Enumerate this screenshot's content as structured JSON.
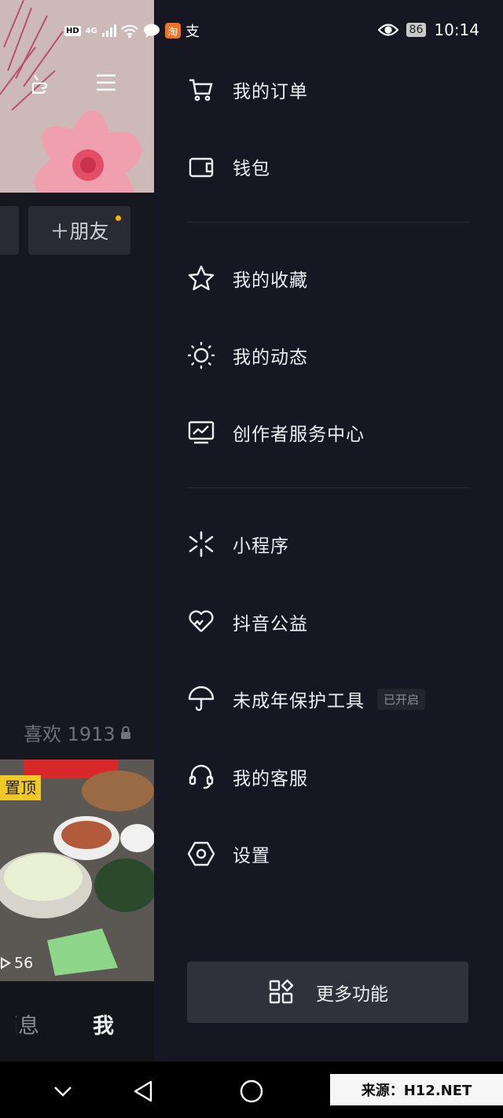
{
  "status_bar": {
    "hd": "HD",
    "network": "4G",
    "battery": "86",
    "time": "10:14",
    "alipay_glyph": "支",
    "taobao_glyph": "淘"
  },
  "background_profile": {
    "add_friend_label": "＋朋友",
    "likes_label": "喜欢 1913",
    "pinned_label": "置顶",
    "play_count": "56",
    "tab_messages": "消息",
    "tab_me": "我"
  },
  "drawer": {
    "items": [
      {
        "label": "我的订单",
        "icon": "cart-icon"
      },
      {
        "label": "钱包",
        "icon": "wallet-icon"
      },
      {
        "label": "我的收藏",
        "icon": "star-icon"
      },
      {
        "label": "我的动态",
        "icon": "sun-icon"
      },
      {
        "label": "创作者服务中心",
        "icon": "monitor-chart-icon"
      },
      {
        "label": "小程序",
        "icon": "mini-program-icon"
      },
      {
        "label": "抖音公益",
        "icon": "heart-hands-icon"
      },
      {
        "label": "未成年保护工具",
        "icon": "umbrella-icon",
        "badge": "已开启"
      },
      {
        "label": "我的客服",
        "icon": "headset-icon"
      },
      {
        "label": "设置",
        "icon": "hexagon-gear-icon"
      }
    ],
    "more_button_label": "更多功能"
  },
  "watermark": "来源：H12.NET",
  "colors": {
    "drawer_bg": "#161722",
    "more_button_bg": "#30313b",
    "pin_badge": "#f0c928",
    "accent_dot": "#f4b400"
  }
}
